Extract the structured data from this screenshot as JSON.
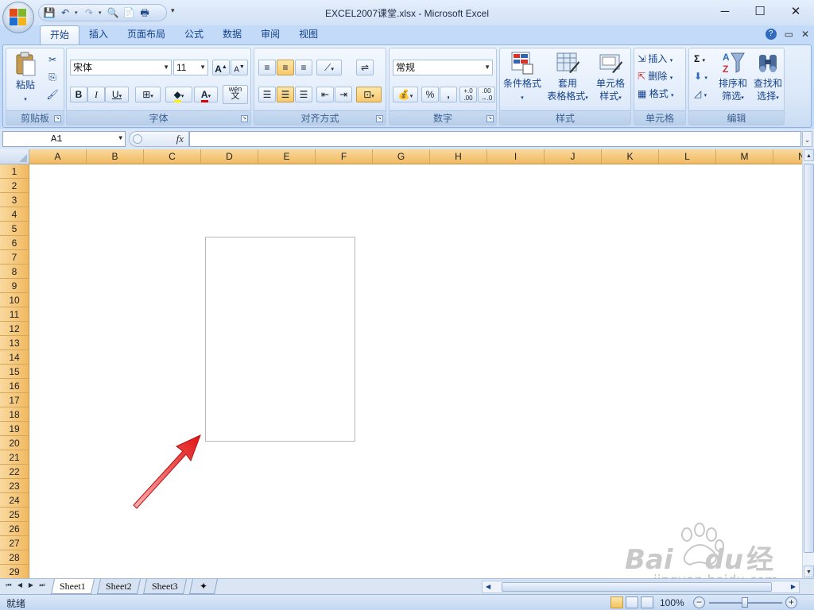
{
  "window": {
    "title": "EXCEL2007课堂.xlsx - Microsoft Excel",
    "minimize": "─",
    "maximize": "☐",
    "close": "✕"
  },
  "ribbon_tabs": [
    {
      "label": "开始",
      "active": true
    },
    {
      "label": "插入"
    },
    {
      "label": "页面布局"
    },
    {
      "label": "公式"
    },
    {
      "label": "数据"
    },
    {
      "label": "审阅"
    },
    {
      "label": "视图"
    }
  ],
  "ribbon_controls": {
    "help": "?",
    "restore": "▭",
    "close": "✕"
  },
  "groups": {
    "clipboard": {
      "label": "剪贴板",
      "paste": "粘贴"
    },
    "font": {
      "label": "字体",
      "font_name": "宋体",
      "font_size": "11",
      "bold": "B",
      "italic": "I",
      "underline": "U",
      "grow": "A",
      "shrink": "A",
      "wen": "wén",
      "wen_char": "文"
    },
    "alignment": {
      "label": "对齐方式"
    },
    "number": {
      "label": "数字",
      "format": "常规",
      "percent": "%",
      "comma": ",",
      "inc_decimal": "+.0 .00",
      "dec_decimal": ".00 →.0"
    },
    "styles": {
      "label": "样式",
      "conditional": "条件格式",
      "table_1": "套用",
      "table_2": "表格格式",
      "cell_1": "单元格",
      "cell_2": "样式"
    },
    "cells": {
      "label": "单元格",
      "insert": "插入",
      "delete": "删除",
      "format": "格式"
    },
    "editing": {
      "label": "编辑",
      "sigma": "Σ",
      "sort_1": "排序和",
      "sort_2": "筛选",
      "find_1": "查找和",
      "find_2": "选择"
    }
  },
  "formula_bar": {
    "name_box": "A1",
    "fx": "fx",
    "value": ""
  },
  "columns": [
    "A",
    "B",
    "C",
    "D",
    "E",
    "F",
    "G",
    "H",
    "I",
    "J",
    "K",
    "L",
    "M",
    "N"
  ],
  "rows": [
    "1",
    "2",
    "3",
    "4",
    "5",
    "6",
    "7",
    "8",
    "9",
    "10",
    "11",
    "12",
    "13",
    "14",
    "15",
    "16",
    "17",
    "18",
    "19",
    "20",
    "21",
    "22",
    "23",
    "24",
    "25",
    "26",
    "27",
    "28",
    "29"
  ],
  "sheets": [
    {
      "label": "Sheet1",
      "active": true
    },
    {
      "label": "Sheet2"
    },
    {
      "label": "Sheet3"
    }
  ],
  "status": {
    "text": "就绪",
    "zoom": "100%"
  },
  "watermark": {
    "brand": "Bai",
    "brand2": "du",
    "cn": "经验",
    "url": "jingyan.baidu.com"
  },
  "colors": {
    "accent": "#f1b960",
    "ribbon": "#dbe8f8",
    "arrow": "#e02020"
  }
}
